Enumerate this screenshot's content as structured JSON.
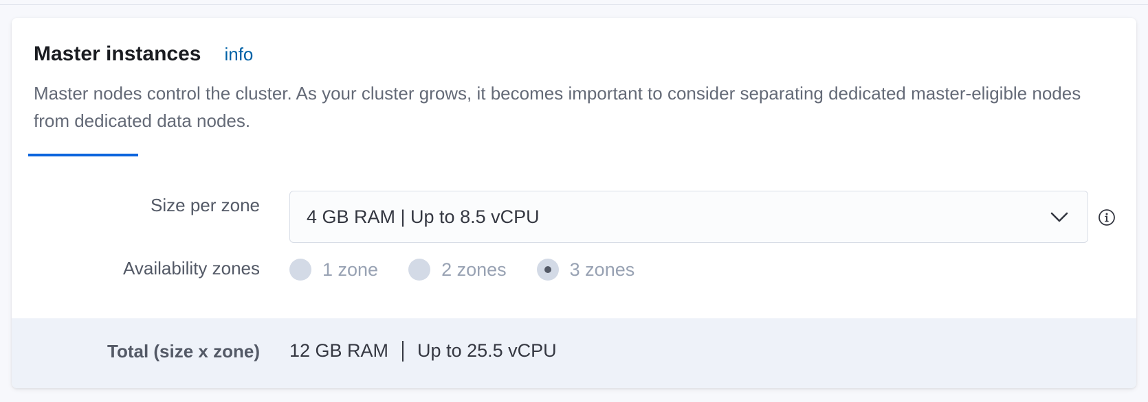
{
  "section": {
    "title": "Master instances",
    "info_link": "info",
    "description": "Master nodes control the cluster. As your cluster grows, it becomes important to consider separating dedicated master-eligible nodes from dedicated data nodes."
  },
  "size": {
    "label": "Size per zone",
    "selected": "4 GB RAM | Up to 8.5 vCPU",
    "help_icon": "info-circle-icon",
    "dropdown_icon": "chevron-down-icon"
  },
  "zones": {
    "label": "Availability zones",
    "options": [
      {
        "label": "1 zone",
        "selected": false,
        "disabled": true
      },
      {
        "label": "2 zones",
        "selected": false,
        "disabled": true
      },
      {
        "label": "3 zones",
        "selected": true,
        "disabled": true
      }
    ]
  },
  "total": {
    "label": "Total (size x zone)",
    "ram": "12 GB RAM",
    "cpu": "Up to 25.5 vCPU"
  },
  "colors": {
    "accent": "#0b64dd",
    "link": "#0061a6",
    "footer_bg": "#eef2f9"
  }
}
